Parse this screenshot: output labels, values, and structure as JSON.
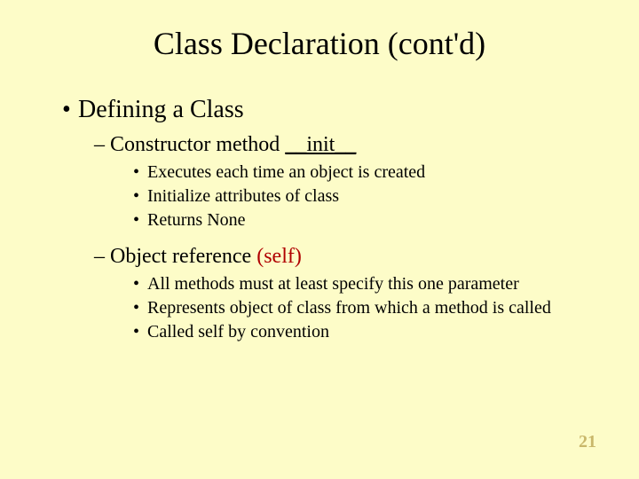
{
  "title": "Class Declaration (cont'd)",
  "l1": {
    "bullet": "•",
    "text": "Defining a Class"
  },
  "sec1": {
    "bullet": "–",
    "prefix": "Constructor method ",
    "underlined": "__init__",
    "items": [
      {
        "bullet": "•",
        "text": "Executes each time an object is created"
      },
      {
        "bullet": "•",
        "text": "Initialize attributes of class"
      },
      {
        "bullet": "•",
        "text": "Returns None"
      }
    ]
  },
  "sec2": {
    "bullet": "–",
    "prefix": "Object reference ",
    "paren_open": "(",
    "red": "self",
    "paren_close": ")",
    "items": [
      {
        "bullet": "•",
        "text": "All methods must at least specify this one parameter"
      },
      {
        "bullet": "•",
        "text": "Represents object of class from which a method is called"
      },
      {
        "bullet": "•",
        "text": "Called self by convention"
      }
    ]
  },
  "page_number": "21"
}
